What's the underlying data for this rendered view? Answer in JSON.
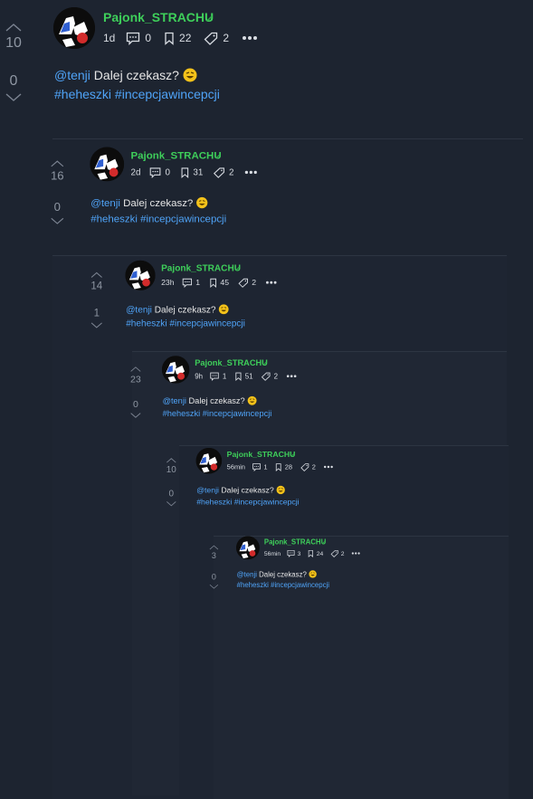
{
  "comments": [
    {
      "username": "Pajonk_STRACHU",
      "time": "1d",
      "replies": "0",
      "saves": "22",
      "tags": "2",
      "upvotes": "10",
      "downvotes": "0",
      "mention": "@tenji",
      "text": "Dalej czekasz?",
      "hashtags": "#heheszki #incepcjawincepcji"
    },
    {
      "username": "Pajonk_STRACHU",
      "time": "2d",
      "replies": "0",
      "saves": "31",
      "tags": "2",
      "upvotes": "16",
      "downvotes": "0",
      "mention": "@tenji",
      "text": "Dalej czekasz?",
      "hashtags": "#heheszki #incepcjawincepcji"
    },
    {
      "username": "Pajonk_STRACHU",
      "time": "23h",
      "replies": "1",
      "saves": "45",
      "tags": "2",
      "upvotes": "14",
      "downvotes": "1",
      "mention": "@tenji",
      "text": "Dalej czekasz?",
      "hashtags": "#heheszki #incepcjawincepcji"
    },
    {
      "username": "Pajonk_STRACHU",
      "time": "9h",
      "replies": "1",
      "saves": "51",
      "tags": "2",
      "upvotes": "23",
      "downvotes": "0",
      "mention": "@tenji",
      "text": "Dalej czekasz?",
      "hashtags": "#heheszki #incepcjawincepcji"
    },
    {
      "username": "Pajonk_STRACHU",
      "time": "56min",
      "replies": "1",
      "saves": "28",
      "tags": "2",
      "upvotes": "10",
      "downvotes": "0",
      "mention": "@tenji",
      "text": "Dalej czekasz?",
      "hashtags": "#heheszki #incepcjawincepcji"
    },
    {
      "username": "Pajonk_STRACHU",
      "time": "56min",
      "replies": "3",
      "saves": "24",
      "tags": "2",
      "upvotes": "3",
      "downvotes": "0",
      "mention": "@tenji",
      "text": "Dalej czekasz?",
      "hashtags": "#heheszki #incepcjawincepcji"
    }
  ],
  "colors": {
    "background": "#1d2430",
    "username": "#3ecf5a",
    "link": "#4fa3f7",
    "muted": "#8f97a3"
  }
}
